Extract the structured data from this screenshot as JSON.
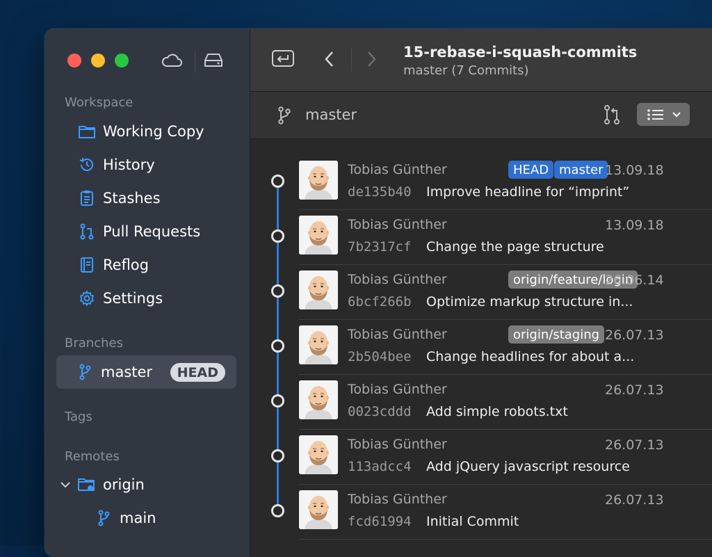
{
  "repo": {
    "name": "15-rebase-i-squash-commits",
    "subtitle": "master (7 Commits)"
  },
  "sidebar": {
    "workspace_title": "Workspace",
    "items": [
      {
        "label": "Working Copy",
        "icon": "folder-icon"
      },
      {
        "label": "History",
        "icon": "clock-history-icon"
      },
      {
        "label": "Stashes",
        "icon": "clipboard-icon"
      },
      {
        "label": "Pull Requests",
        "icon": "pull-request-icon"
      },
      {
        "label": "Reflog",
        "icon": "book-icon"
      },
      {
        "label": "Settings",
        "icon": "gear-icon"
      }
    ],
    "branches_title": "Branches",
    "branch": {
      "name": "master",
      "badge": "HEAD"
    },
    "tags_title": "Tags",
    "remotes_title": "Remotes",
    "remote": {
      "name": "origin",
      "branch": "main"
    }
  },
  "branchbar": {
    "label": "master"
  },
  "commits": [
    {
      "author": "Tobias Günther",
      "hash": "de135b40",
      "message": "Improve headline for “imprint”",
      "date": "13.09.18",
      "tags": [
        {
          "label": "HEAD",
          "style": "blue"
        },
        {
          "label": "master",
          "style": "blue"
        }
      ]
    },
    {
      "author": "Tobias Günther",
      "hash": "7b2317cf",
      "message": "Change the page structure",
      "date": "13.09.18",
      "tags": []
    },
    {
      "author": "Tobias Günther",
      "hash": "6bcf266b",
      "message": "Optimize markup structure in...",
      "date": "26.06.14",
      "tags": [
        {
          "label": "origin/feature/login",
          "style": "gray"
        }
      ]
    },
    {
      "author": "Tobias Günther",
      "hash": "2b504bee",
      "message": "Change headlines for about a...",
      "date": "26.07.13",
      "tags": [
        {
          "label": "origin/staging",
          "style": "gray"
        }
      ]
    },
    {
      "author": "Tobias Günther",
      "hash": "0023cddd",
      "message": "Add simple robots.txt",
      "date": "26.07.13",
      "tags": []
    },
    {
      "author": "Tobias Günther",
      "hash": "113adcc4",
      "message": "Add jQuery javascript resource",
      "date": "26.07.13",
      "tags": []
    },
    {
      "author": "Tobias Günther",
      "hash": "fcd61994",
      "message": "Initial Commit",
      "date": "26.07.13",
      "tags": []
    }
  ],
  "colors": {
    "accent": "#2f7ee0",
    "tag_blue": "#2f6fce",
    "tag_gray": "#7b7b7b"
  }
}
